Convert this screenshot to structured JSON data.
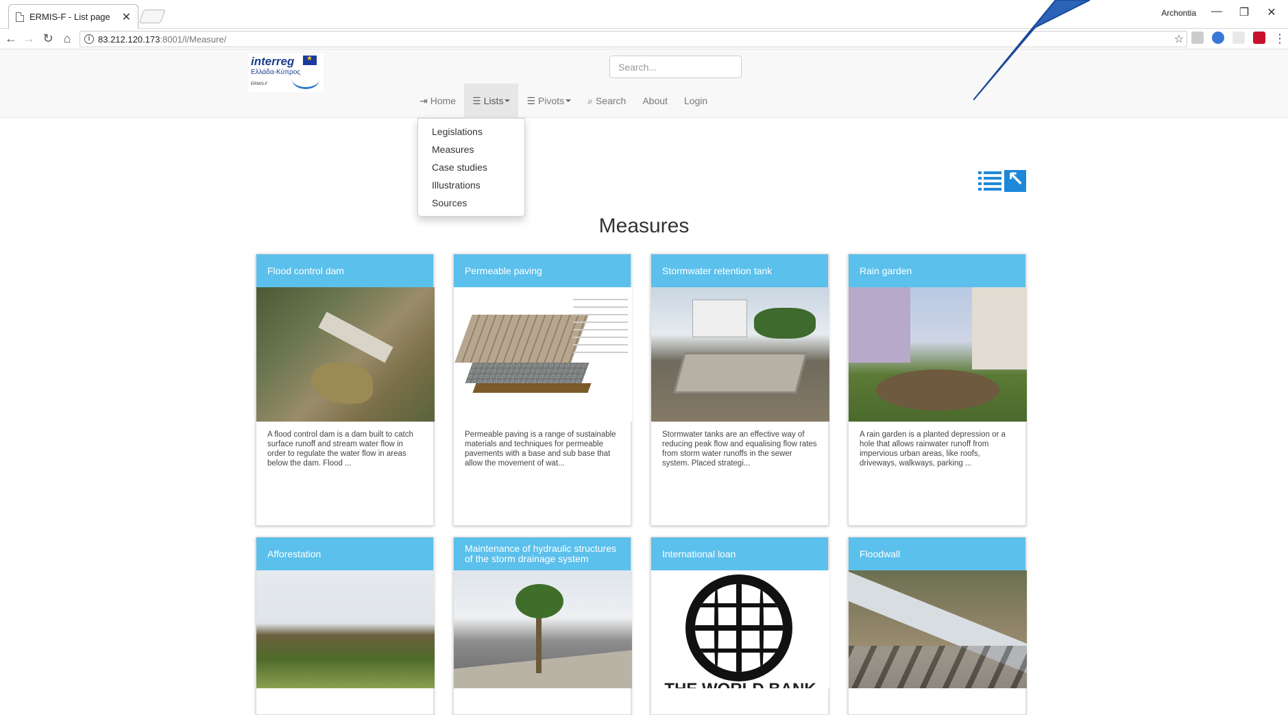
{
  "browser": {
    "tab_title": "ERMIS-F - List page",
    "tab_close": "✕",
    "profile_name": "Archontia",
    "url_host": "83.212.120.173",
    "url_rest": ":8001/l/Measure/",
    "win_minimize": "—",
    "win_restore": "❐",
    "win_close": "✕"
  },
  "header": {
    "logo_text": "interreg",
    "logo_sub": "Ελλάδα-Κύπρος",
    "logo_mini": "ERMIS-F",
    "search_placeholder": "Search..."
  },
  "nav": {
    "home": "Home",
    "lists": "Lists",
    "pivots": "Pivots",
    "search": "Search",
    "about": "About",
    "login": "Login"
  },
  "dropdown": {
    "items": [
      "Legislations",
      "Measures",
      "Case studies",
      "Illustrations",
      "Sources"
    ]
  },
  "page": {
    "title": "Measures"
  },
  "cards": [
    {
      "title": "Flood control dam",
      "text": "A flood control dam is a dam built to catch surface runoff and stream water flow in order to regulate the water flow in areas below the dam. Flood ..."
    },
    {
      "title": "Permeable paving",
      "text": "Permeable paving is a range of sustainable materials and techniques for permeable pavements with a base and sub base that allow the movement of wat..."
    },
    {
      "title": "Stormwater retention tank",
      "text": "Stormwater tanks are an effective way of reducing peak flow and equalising flow rates from storm water runoffs in the sewer system. Placed strategi..."
    },
    {
      "title": "Rain garden",
      "text": "A rain garden is a planted depression or a hole that allows rainwater runoff from impervious urban areas, like roofs, driveways, walkways, parking ..."
    },
    {
      "title": "Afforestation",
      "text": ""
    },
    {
      "title": "Maintenance of hydraulic structures of the storm drainage system",
      "text": ""
    },
    {
      "title": "International loan",
      "text": ""
    },
    {
      "title": "Floodwall",
      "text": ""
    }
  ],
  "images": {
    "world_bank_text": "THE WORLD BANK"
  },
  "colors": {
    "card_header": "#5bc0eb",
    "view_icon": "#1e88d8",
    "arrow": "#2a63b8"
  }
}
